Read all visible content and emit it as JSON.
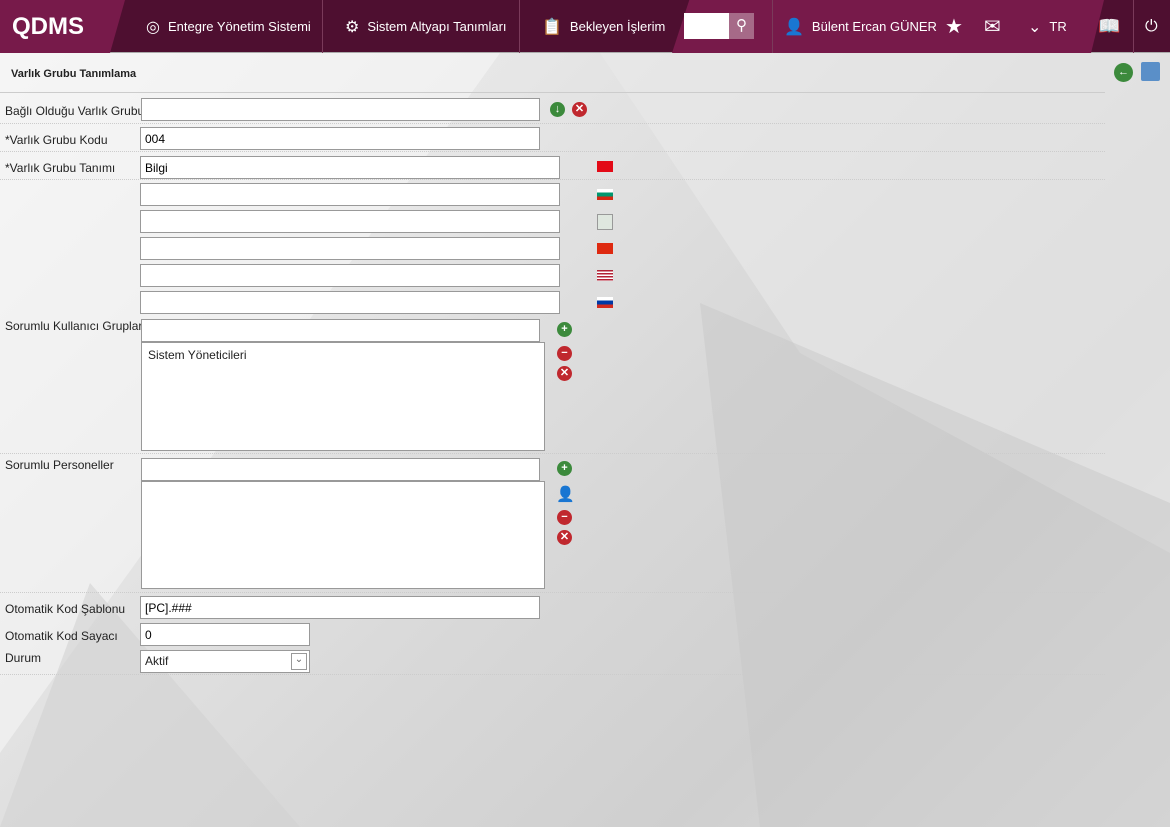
{
  "header": {
    "logo": "QDMS",
    "nav": [
      {
        "label": "Entegre Yönetim Sistemi",
        "icon": "q-icon"
      },
      {
        "label": "Sistem Altyapı Tanımları",
        "icon": "gear-icon"
      },
      {
        "label": "Bekleyen İşlerim",
        "icon": "clipboard-icon"
      }
    ],
    "search_value": "",
    "user": "Bülent Ercan GÜNER",
    "lang": "TR"
  },
  "page": {
    "title": "Varlık Grubu Tanımlama"
  },
  "form": {
    "parent_label": "Bağlı Olduğu Varlık Grubu",
    "parent_value": "",
    "code_label": "*Varlık Grubu Kodu",
    "code_value": "004",
    "def_label": "*Varlık Grubu Tanımı",
    "def_values": [
      "Bilgi",
      "",
      "",
      "",
      "",
      ""
    ],
    "flags": [
      "tr",
      "bg",
      "broken-image",
      "cn",
      "us",
      "ru"
    ],
    "groups_label": "Sorumlu Kullanıcı Grupları",
    "groups_input": "",
    "groups_list": [
      "Sistem Yöneticileri"
    ],
    "staff_label": "Sorumlu Personeller",
    "staff_input": "",
    "template_label": "Otomatik Kod Şablonu",
    "template_value": "[PC].###",
    "counter_label": "Otomatik Kod Sayacı",
    "counter_value": "0",
    "status_label": "Durum",
    "status_value": "Aktif"
  }
}
